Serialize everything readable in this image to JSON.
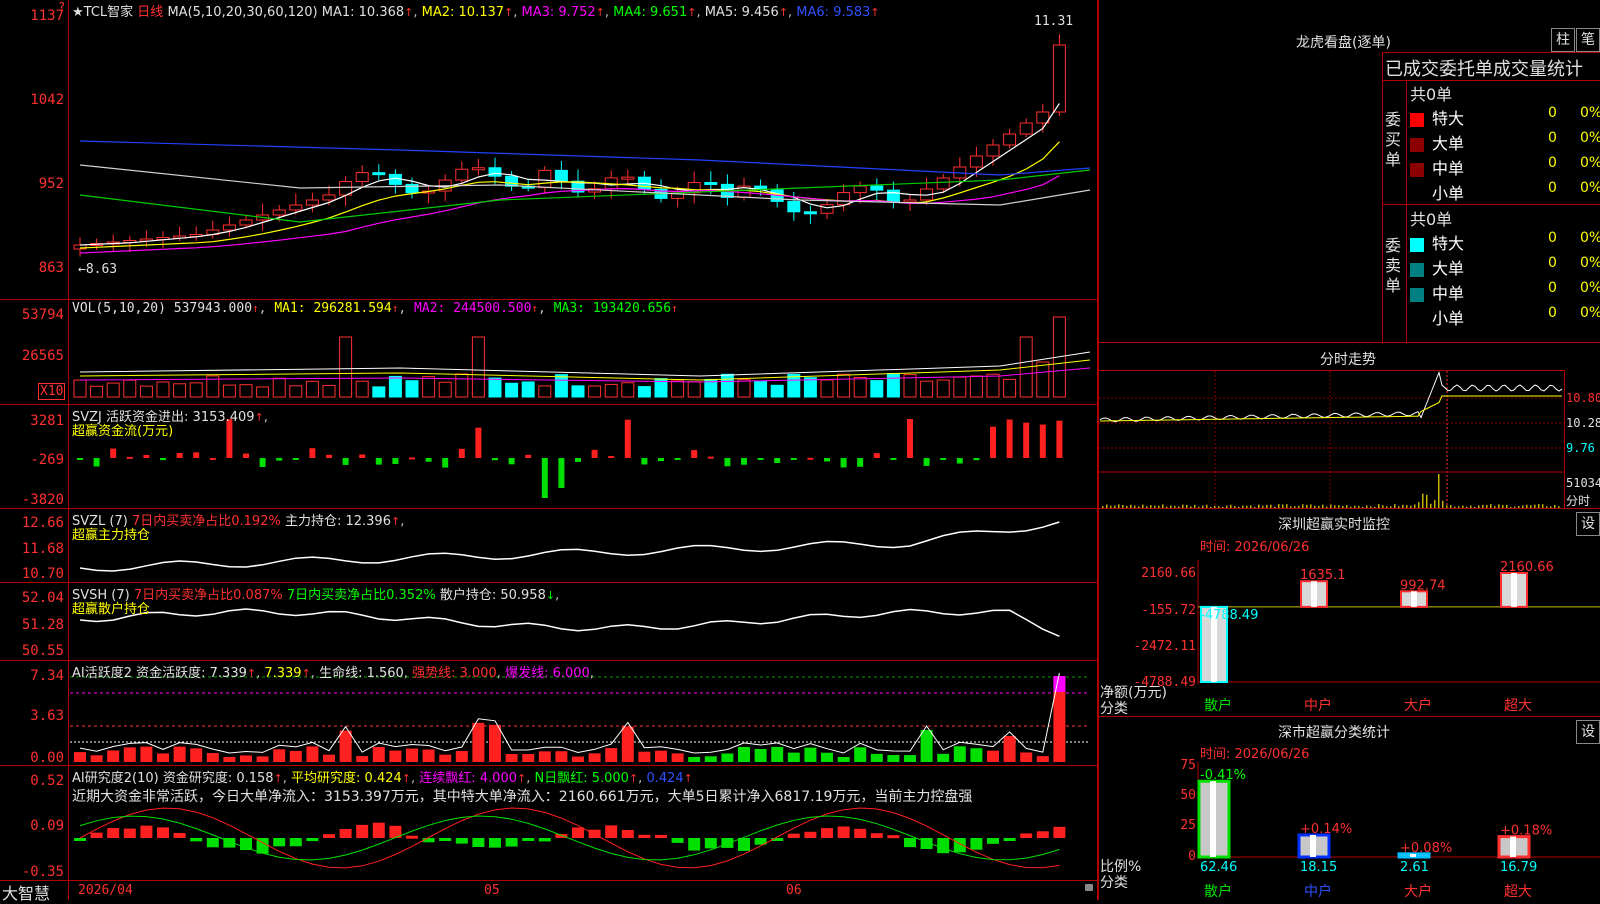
{
  "header": {
    "corner_mark": "?",
    "stock": "★TCL智家",
    "period": "日线",
    "ma_label": "MA(5,10,20,30,60,120)",
    "ma1": "MA1: 10.368",
    "ma2": "MA2: 10.137",
    "ma3": "MA3: 9.752",
    "ma4": "MA4: 9.651",
    "ma5": "MA5: 9.456",
    "ma6": "MA6: 9.583",
    "high_label": "11.31",
    "low_label": "8.63"
  },
  "price_axis": [
    "1137",
    "1042",
    "952",
    "863"
  ],
  "vol": {
    "label": "VOL(5,10,20)",
    "value": "537943.000",
    "ma1": "MA1: 296281.594",
    "ma2": "MA2: 244500.500",
    "ma3": "MA3: 193420.656",
    "axis": [
      "53794",
      "26565"
    ],
    "unit": "X10"
  },
  "svzj": {
    "label": "SVZJ",
    "text": "活跃资金进出: 3153.409",
    "sub": "超赢资金流(万元)",
    "axis": [
      "3281",
      "-269",
      "-3820"
    ]
  },
  "svzl": {
    "label": "SVZL (7)",
    "ratio": "7日内买卖净占比0.192%",
    "text": "主力持仓: 12.396",
    "sub": "超赢主力持仓",
    "axis": [
      "12.66",
      "11.68",
      "10.70"
    ]
  },
  "svsh": {
    "label": "SVSH (7)",
    "ratio1": "7日内买卖净占比0.087%",
    "ratio2": "7日内买卖净占比0.352%",
    "text": "散户持仓: 50.958",
    "sub": "超赢散户持仓",
    "axis": [
      "52.04",
      "51.28",
      "50.55"
    ]
  },
  "ai_active": {
    "label": "AI活跃度2",
    "t1": "资金活跃度: 7.339",
    "t2": "7.339",
    "t3": "生命线: 1.560",
    "t4": "强势线: 3.000",
    "t5": "爆发线: 6.000",
    "axis": [
      "7.34",
      "3.63",
      "0.00"
    ]
  },
  "ai_research": {
    "label": "AI研究度2(10)",
    "t1": "资金研究度: 0.158",
    "t2": "平均研究度: 0.424",
    "t3": "连续飘红: 4.000",
    "t4": "N日飘红: 5.000",
    "t5": "0.424",
    "summary": "近期大资金非常活跃，今日大单净流入：3153.397万元，其中特大单净流入：2160.661万元，大单5日累计净入6817.19万元，当前主力控盘强",
    "axis": [
      "0.52",
      "0.09",
      "-0.35"
    ]
  },
  "bottom": {
    "brand": "大智慧",
    "date": "2026/04",
    "m05": "05",
    "m06": "06"
  },
  "dragon": {
    "title": "龙虎看盘(逐单)",
    "btn1": "柱",
    "btn2": "笔",
    "subtitle": "已成交委托单成交量统计",
    "buy_side": "委买单",
    "sell_side": "委卖单",
    "buy_total": "共0单",
    "sell_total": "共0单",
    "buy_rows": [
      {
        "label": "特大",
        "n": "0",
        "p": "0%",
        "color": "#ff0000"
      },
      {
        "label": "大单",
        "n": "0",
        "p": "0%",
        "color": "#8b0000"
      },
      {
        "label": "中单",
        "n": "0",
        "p": "0%",
        "color": "#8b0000"
      },
      {
        "label": "小单",
        "n": "0",
        "p": "0%",
        "color": "#000000"
      }
    ],
    "sell_rows": [
      {
        "label": "特大",
        "n": "0",
        "p": "0%",
        "color": "#00ffff"
      },
      {
        "label": "大单",
        "n": "0",
        "p": "0%",
        "color": "#008080"
      },
      {
        "label": "中单",
        "n": "0",
        "p": "0%",
        "color": "#008080"
      },
      {
        "label": "小单",
        "n": "0",
        "p": "0%",
        "color": "#000000"
      }
    ]
  },
  "intraday": {
    "title": "分时走势",
    "axis": [
      "10.80",
      "10.28",
      "9.76"
    ],
    "vol": "51034",
    "vol_unit": "分时"
  },
  "monitor": {
    "title": "深圳超赢实时监控",
    "btn": "设",
    "time": "时间: 2026/06/26",
    "axis": [
      "2160.66",
      "-155.72",
      "-2472.11",
      "-4788.49"
    ],
    "ylabel": "净额(万元)",
    "xlabel": "分类",
    "categories": [
      "散户",
      "中户",
      "大户",
      "超大"
    ],
    "values": [
      -4788.49,
      1635.1,
      992.74,
      2160.66
    ],
    "labels": [
      "-4788.49",
      "1635.1",
      "992.74",
      "2160.66"
    ]
  },
  "classify": {
    "title": "深市超赢分类统计",
    "btn": "设",
    "time": "时间: 2026/06/26",
    "axis": [
      "75",
      "50",
      "25",
      "0"
    ],
    "ylabel": "比例%",
    "xlabel": "分类",
    "categories": [
      "散户",
      "中户",
      "大户",
      "超大"
    ],
    "values": [
      62.46,
      18.15,
      2.61,
      16.79
    ],
    "labels": [
      "62.46",
      "18.15",
      "2.61",
      "16.79"
    ],
    "changes": [
      "-0.41%",
      "+0.14%",
      "+0.08%",
      "+0.18%"
    ]
  },
  "chart_data": [
    {
      "type": "bar",
      "title": "深圳超赢实时监控",
      "ylabel": "净额(万元)",
      "categories": [
        "散户",
        "中户",
        "大户",
        "超大"
      ],
      "values": [
        -4788.49,
        1635.1,
        992.74,
        2160.66
      ],
      "ylim": [
        -4788.49,
        2160.66
      ]
    },
    {
      "type": "bar",
      "title": "深市超赢分类统计",
      "ylabel": "比例%",
      "categories": [
        "散户",
        "中户",
        "大户",
        "超大"
      ],
      "values": [
        62.46,
        18.15,
        2.61,
        16.79
      ],
      "ylim": [
        0,
        75
      ]
    }
  ]
}
